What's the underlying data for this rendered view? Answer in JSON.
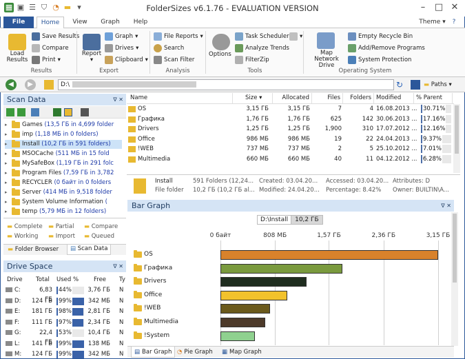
{
  "window": {
    "title": "FolderSizes v6.1.76 - EVALUATION VERSION"
  },
  "tabs": [
    "File",
    "Home",
    "View",
    "Graph",
    "Help"
  ],
  "theme": "Theme",
  "ribbon": {
    "results": {
      "load": "Load Results",
      "save": "Save Results",
      "compare": "Compare",
      "print": "Print",
      "group": "Results"
    },
    "export": {
      "report": "Report",
      "graph": "Graph",
      "drives": "Drives",
      "clipboard": "Clipboard",
      "group": "Export"
    },
    "analysis": {
      "file_reports": "File Reports",
      "search": "Search",
      "scan_filter": "Scan Filter",
      "group": "Analysis"
    },
    "tools": {
      "options": "Options",
      "task_scheduler": "Task Scheduler",
      "analyze_trends": "Analyze Trends",
      "filezip": "FilterZip",
      "group": "Tools"
    },
    "opsys": {
      "map_network": "Map Network Drive",
      "empty_recycle": "Empty Recycle Bin",
      "add_remove": "Add/Remove Programs",
      "system_protection": "System Protection",
      "group": "Operating System"
    }
  },
  "address": {
    "path": "D:\\",
    "paths_label": "Paths"
  },
  "scan_data": {
    "title": "Scan Data",
    "items": [
      {
        "name": "Games",
        "detail": "(13,5 ГБ in 4,699 folder"
      },
      {
        "name": "imp",
        "detail": "(1,18 МБ in 0 folders)"
      },
      {
        "name": "Install",
        "detail": "(10,2 ГБ in 591 folders)"
      },
      {
        "name": "MSOCache",
        "detail": "(511 МБ in 15 fold"
      },
      {
        "name": "MySafeBox",
        "detail": "(1,19 ГБ in 291 folc"
      },
      {
        "name": "Program Files",
        "detail": "(7,59 ГБ in 3,782"
      },
      {
        "name": "RECYCLER",
        "detail": "(0 байт in 0 folders"
      },
      {
        "name": "Server",
        "detail": "(414 МБ in 9,518 folder"
      },
      {
        "name": "System Volume Information",
        "detail": "("
      },
      {
        "name": "temp",
        "detail": "(5,79 МБ in 12 folders)"
      }
    ],
    "legend": [
      "Complete",
      "Partial",
      "Compare",
      "Working",
      "Import",
      "Queued"
    ],
    "tabs": [
      "Folder Browser",
      "Scan Data"
    ]
  },
  "drive_space": {
    "title": "Drive Space",
    "headers": [
      "Drive",
      "Total",
      "Used %",
      "Free",
      "Ty"
    ],
    "rows": [
      [
        "C:",
        "6,83 ГБ",
        "44%",
        "3,76 ГБ",
        "N"
      ],
      [
        "D:",
        "124 ГБ",
        "99%",
        "342 МБ",
        "N"
      ],
      [
        "E:",
        "181 ГБ",
        "98%",
        "2,81 ГБ",
        "N"
      ],
      [
        "F:",
        "111 ГБ",
        "97%",
        "2,34 ГБ",
        "N"
      ],
      [
        "G:",
        "22,4 ГБ",
        "53%",
        "10,4 ГБ",
        "N"
      ],
      [
        "L:",
        "141 ГБ",
        "99%",
        "138 МБ",
        "N"
      ],
      [
        "M:",
        "124 ГБ",
        "99%",
        "342 МБ",
        "N"
      ]
    ],
    "used_fraction": [
      0.44,
      0.99,
      0.98,
      0.97,
      0.53,
      0.99,
      0.99
    ]
  },
  "table": {
    "headers": [
      "Name",
      "Size",
      "Allocated",
      "Files",
      "Folders",
      "Modified",
      "% Parent"
    ],
    "rows": [
      [
        "OS",
        "3,15 ГБ",
        "3,15 ГБ",
        "7",
        "4",
        "16.08.2013 ...",
        "30.71%"
      ],
      [
        "Графика",
        "1,76 ГБ",
        "1,76 ГБ",
        "625",
        "142",
        "30.06.2013 ...",
        "17.16%"
      ],
      [
        "Drivers",
        "1,25 ГБ",
        "1,25 ГБ",
        "1,900",
        "310",
        "17.07.2012 ...",
        "12.16%"
      ],
      [
        "Office",
        "986 МБ",
        "986 МБ",
        "19",
        "22",
        "24.04.2013 ...",
        "9.37%"
      ],
      [
        "!WEB",
        "737 МБ",
        "737 МБ",
        "2",
        "5",
        "25.10.2012 ...",
        "7.01%"
      ],
      [
        "Multimedia",
        "660 МБ",
        "660 МБ",
        "40",
        "11",
        "04.12.2012 ...",
        "6.28%"
      ]
    ],
    "pct_values": [
      30.71,
      17.16,
      12.16,
      9.37,
      7.01,
      6.28
    ]
  },
  "details": {
    "name": "Install",
    "type": "File folder",
    "line1b": "591 Folders (12,24...",
    "line2b": "10,2 ГБ (10,2 ГБ al...",
    "created": "Created: 03.04.20...",
    "modified": "Modified: 24.04.20...",
    "accessed": "Accessed: 03.04.20...",
    "percentage": "Percentage: 8.42%",
    "attributes": "Attributes: D",
    "owner": "Owner: BUILTIN\\A..."
  },
  "bar_graph": {
    "title": "Bar Graph",
    "path": "D:\\Install",
    "total": "10,2 ГБ",
    "tabs": [
      "Bar Graph",
      "Pie Graph",
      "Map Graph"
    ]
  },
  "chart_data": {
    "type": "bar",
    "categories": [
      "OS",
      "Графика",
      "Drivers",
      "Office",
      "!WEB",
      "Multimedia",
      "!System"
    ],
    "values": [
      3.15,
      1.76,
      1.25,
      0.963,
      0.72,
      0.645,
      0.5
    ],
    "tick_labels": [
      "0 байт",
      "808 МБ",
      "1,57 ГБ",
      "2,36 ГБ",
      "3,15 ГБ"
    ],
    "xlim": [
      0,
      3.15
    ],
    "colors": [
      "#d9822b",
      "#7a9a3e",
      "#1f2d1f",
      "#f2c22c",
      "#6b5a1c",
      "#4d3a2a",
      "#8fd18f"
    ]
  }
}
